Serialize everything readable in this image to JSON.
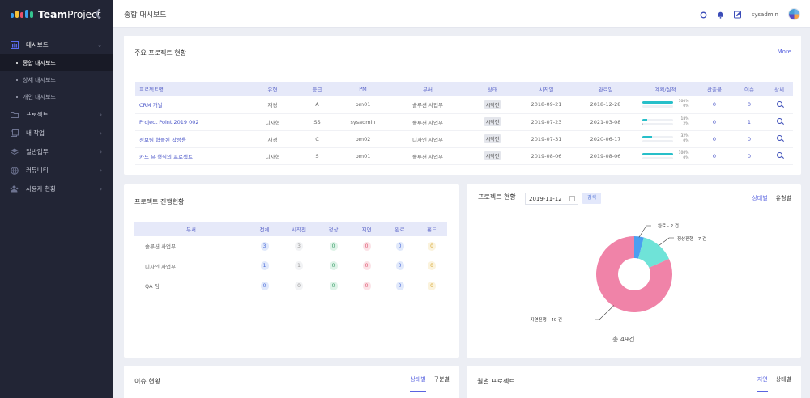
{
  "app": {
    "name": "Team",
    "name2": "Project"
  },
  "topbar": {
    "title": "종합 대시보드",
    "user": "sysadmin"
  },
  "sidebar": {
    "items": [
      {
        "label": "대시보드",
        "icon": "bar-chart-icon"
      },
      {
        "label": "종합 대시보드"
      },
      {
        "label": "상세 대시보드"
      },
      {
        "label": "개인 대시보드"
      },
      {
        "label": "프로젝트",
        "icon": "folder-icon"
      },
      {
        "label": "내 작업",
        "icon": "task-icon"
      },
      {
        "label": "일반업무",
        "icon": "layers-icon"
      },
      {
        "label": "커뮤니티",
        "icon": "globe-icon"
      },
      {
        "label": "사용자 현황",
        "icon": "users-icon"
      }
    ]
  },
  "projects": {
    "title": "주요 프로젝트 현황",
    "more": "More",
    "headers": [
      "프로젝트명",
      "유형",
      "등급",
      "PM",
      "부서",
      "상태",
      "시작일",
      "완료일",
      "계획/실적",
      "산출물",
      "이슈",
      "상세"
    ],
    "rows": [
      {
        "name": "CRM 개발",
        "type": "재경",
        "grade": "A",
        "pm": "pm01",
        "dept": "솔루션 사업부",
        "status": "시작전",
        "start": "2018-09-21",
        "end": "2018-12-28",
        "plan": "100%",
        "actual": "0%",
        "plan_v": 1.0,
        "actual_v": 0,
        "output": "0",
        "issue": "0"
      },
      {
        "name": "Project Point 2019 002",
        "type": "디자형",
        "grade": "SS",
        "pm": "sysadmin",
        "dept": "솔루션 사업부",
        "status": "시작전",
        "start": "2019-07-23",
        "end": "2021-03-08",
        "plan": "18%",
        "actual": "2%",
        "plan_v": 0.18,
        "actual_v": 0.02,
        "output": "0",
        "issue": "1"
      },
      {
        "name": "정보팀 협플된 작성용",
        "type": "재경",
        "grade": "C",
        "pm": "pm02",
        "dept": "디자인 사업부",
        "status": "시작전",
        "start": "2019-07-31",
        "end": "2020-06-17",
        "plan": "32%",
        "actual": "0%",
        "plan_v": 0.32,
        "actual_v": 0,
        "output": "0",
        "issue": "0"
      },
      {
        "name": "카드 뷰 형식의 프로젝트",
        "type": "디자형",
        "grade": "S",
        "pm": "pm01",
        "dept": "솔루션 사업부",
        "status": "시작전",
        "start": "2019-08-06",
        "end": "2019-08-06",
        "plan": "100%",
        "actual": "0%",
        "plan_v": 1.0,
        "actual_v": 0,
        "output": "0",
        "issue": "0"
      }
    ]
  },
  "progress": {
    "title": "프로젝트 진행현황",
    "headers": [
      "부서",
      "전체",
      "시작전",
      "정상",
      "지연",
      "완료",
      "홀드"
    ],
    "rows": [
      {
        "dept": "솔루션 사업부",
        "vals": [
          "3",
          "3",
          "0",
          "0",
          "0",
          "0"
        ]
      },
      {
        "dept": "디자인 사업부",
        "vals": [
          "1",
          "1",
          "0",
          "0",
          "0",
          "0"
        ]
      },
      {
        "dept": "QA 팀",
        "vals": [
          "0",
          "0",
          "0",
          "0",
          "0",
          "0"
        ]
      }
    ]
  },
  "status_chart": {
    "title": "프로젝트 현황",
    "date": "2019-11-12",
    "search": "검색",
    "tabs": [
      "상태별",
      "유형별"
    ],
    "total": "총 49건"
  },
  "chart_data": {
    "type": "pie",
    "title": "",
    "categories": [
      "완료",
      "정상진행",
      "지연진행"
    ],
    "values": [
      2,
      7,
      40
    ],
    "labels": [
      "완료 - 2 건",
      "정상진행 - 7 건",
      "지연진행 - 40 건"
    ],
    "colors": [
      "#4a9ff0",
      "#6fe3d8",
      "#f083a8"
    ]
  },
  "issues": {
    "title": "이슈 현황",
    "tabs": [
      "상태별",
      "구분별"
    ]
  },
  "monthly": {
    "title": "월별 프로젝트",
    "tabs": [
      "지연",
      "상태별"
    ]
  }
}
